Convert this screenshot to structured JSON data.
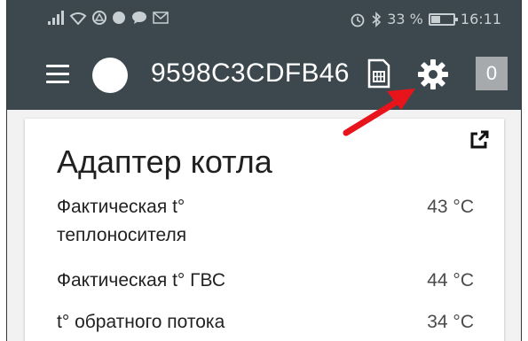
{
  "status_bar": {
    "battery": "33 %",
    "time": "16:11"
  },
  "header": {
    "device_id": "9598C3CDFB46",
    "badge_count": "0"
  },
  "card": {
    "title": "Адаптер котла",
    "rows": [
      {
        "label_line1": "Фактическая t°",
        "label_line2": "теплоносителя",
        "value": "43 °C"
      },
      {
        "label_line1": "Фактическая t° ГВС",
        "value": "44 °C"
      },
      {
        "label_line1": "t° обратного потока",
        "value": "34 °C"
      }
    ]
  },
  "icons": [
    "menu-icon",
    "sim-card-icon",
    "gear-icon",
    "external-link-icon",
    "alarm-icon",
    "bluetooth-icon",
    "battery-icon"
  ],
  "colors": {
    "appbar": "#3c484e",
    "badge": "#a7aaac",
    "arrow": "#e8141b"
  }
}
